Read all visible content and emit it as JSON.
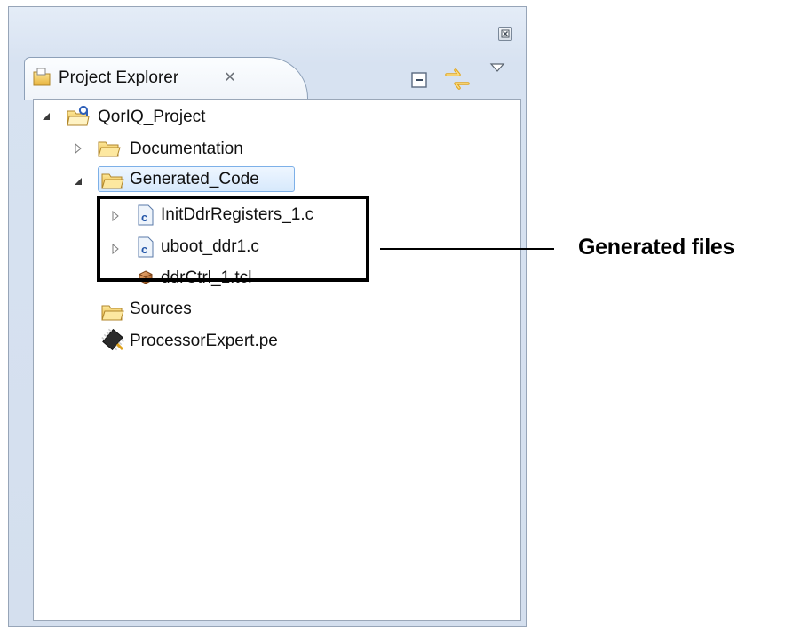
{
  "panel": {
    "tab_title": "Project Explorer",
    "tab_close_glyph": "✕"
  },
  "toolbar": {
    "icons": [
      "collapse-all-icon",
      "link-with-editor-icon",
      "view-menu-icon"
    ]
  },
  "tree": {
    "root": "QorIQ_Project",
    "items": [
      {
        "label": "Documentation",
        "icon": "folder-icon"
      },
      {
        "label": "Generated_Code",
        "icon": "folder-icon",
        "selected": true
      },
      {
        "label": "InitDdrRegisters_1.c",
        "icon": "c-file-icon"
      },
      {
        "label": "uboot_ddr1.c",
        "icon": "c-file-icon"
      },
      {
        "label": "ddrCtrl_1.tcl",
        "icon": "tcl-file-icon"
      },
      {
        "label": "Sources",
        "icon": "folder-icon"
      },
      {
        "label": "ProcessorExpert.pe",
        "icon": "processor-expert-icon"
      }
    ]
  },
  "annotation": {
    "callout": "Generated files"
  },
  "colors": {
    "selection": "#d7e9fc",
    "panel_bg": "#d7e2f1",
    "folder": "#f2c84b"
  }
}
